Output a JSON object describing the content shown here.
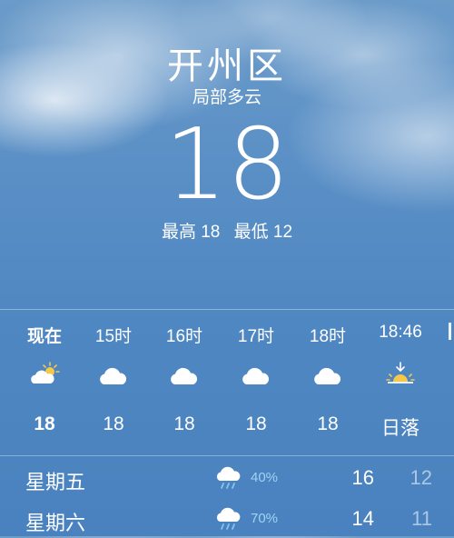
{
  "location": {
    "city": "开州区",
    "condition": "局部多云",
    "temperature": "18",
    "high": "最高 18",
    "low": "最低 12"
  },
  "hourly": [
    {
      "label": "现在",
      "icon": "partly-sunny-icon",
      "temp": "18"
    },
    {
      "label": "15时",
      "icon": "cloud-icon",
      "temp": "18"
    },
    {
      "label": "16时",
      "icon": "cloud-icon",
      "temp": "18"
    },
    {
      "label": "17时",
      "icon": "cloud-icon",
      "temp": "18"
    },
    {
      "label": "18时",
      "icon": "cloud-icon",
      "temp": "18"
    },
    {
      "label": "18:46",
      "icon": "sunset-icon",
      "temp": "日落"
    }
  ],
  "daily": [
    {
      "day": "星期五",
      "icon": "rain-cloud-icon",
      "precip": "40%",
      "high": "16",
      "low": "12"
    },
    {
      "day": "星期六",
      "icon": "rain-cloud-icon",
      "precip": "70%",
      "high": "14",
      "low": "11"
    }
  ],
  "colors": {
    "sky_top": "#6b9bc9",
    "sky_bottom": "#4a82bf",
    "precip_text": "#9fd4f3",
    "sun": "#f5c84a"
  }
}
